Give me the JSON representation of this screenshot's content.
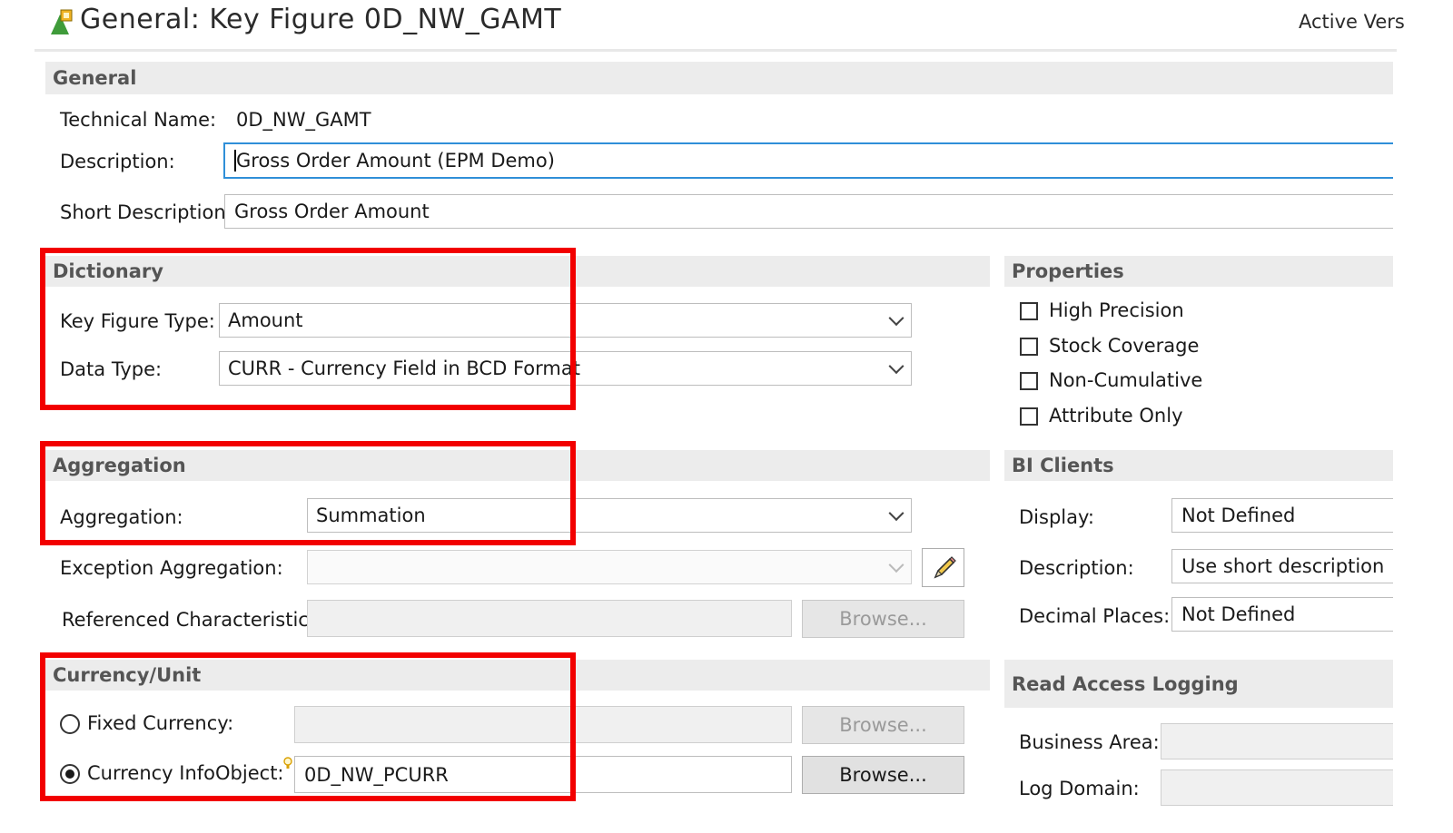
{
  "header": {
    "title": "General: Key Figure 0D_NW_GAMT",
    "version_status": "Active Vers"
  },
  "general": {
    "section_title": "General",
    "technical_name_label": "Technical Name:",
    "technical_name_value": "0D_NW_GAMT",
    "description_label": "Description:",
    "description_value": "Gross Order Amount (EPM Demo)",
    "short_description_label": "Short Description:",
    "short_description_value": "Gross Order Amount"
  },
  "dictionary": {
    "section_title": "Dictionary",
    "key_figure_type_label": "Key Figure Type:",
    "key_figure_type_value": "Amount",
    "data_type_label": "Data Type:",
    "data_type_value": "CURR - Currency Field in BCD Format"
  },
  "properties": {
    "section_title": "Properties",
    "checkboxes": [
      {
        "label": "High Precision",
        "checked": false
      },
      {
        "label": "Stock Coverage",
        "checked": false
      },
      {
        "label": "Non-Cumulative",
        "checked": false
      },
      {
        "label": "Attribute Only",
        "checked": false
      }
    ]
  },
  "aggregation": {
    "section_title": "Aggregation",
    "aggregation_label": "Aggregation:",
    "aggregation_value": "Summation",
    "exception_aggregation_label": "Exception Aggregation:",
    "exception_aggregation_value": "",
    "referenced_characteristic_label": "Referenced Characteristic:",
    "referenced_characteristic_value": "",
    "browse_label": "Browse..."
  },
  "bi_clients": {
    "section_title": "BI Clients",
    "display_label": "Display:",
    "display_value": "Not Defined",
    "description_label": "Description:",
    "description_value": "Use short description",
    "decimal_places_label": "Decimal Places:",
    "decimal_places_value": "Not Defined"
  },
  "currency_unit": {
    "section_title": "Currency/Unit",
    "fixed_currency_label": "Fixed Currency:",
    "fixed_currency_value": "",
    "fixed_currency_selected": false,
    "currency_infoobject_label": "Currency InfoObject:",
    "currency_infoobject_value": "0D_NW_PCURR",
    "currency_infoobject_selected": true,
    "browse_label": "Browse..."
  },
  "read_access_logging": {
    "section_title": "Read Access Logging",
    "business_area_label": "Business Area:",
    "business_area_value": "",
    "log_domain_label": "Log Domain:",
    "log_domain_value": ""
  },
  "colors": {
    "highlight_box": "#f20000",
    "focus_border": "#2f8fd8",
    "section_bg": "#ececec"
  }
}
